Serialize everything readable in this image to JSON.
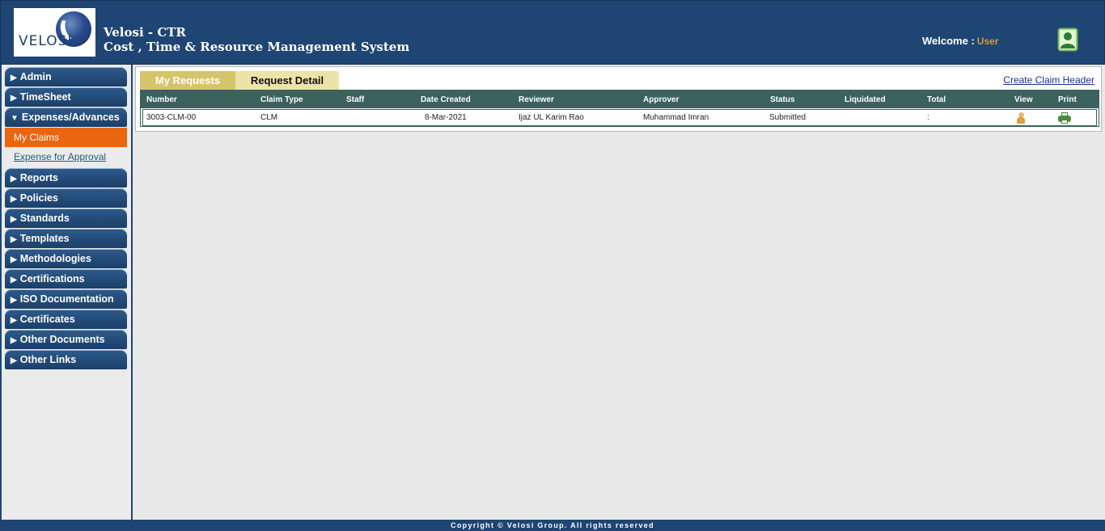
{
  "header": {
    "logo_text": "VELOSI",
    "app_name": "Velosi - CTR",
    "app_subtitle": "Cost , Time & Resource Management System",
    "welcome_label": "Welcome :",
    "user_name": "User"
  },
  "sidebar": {
    "items": [
      {
        "label": "Admin",
        "expanded": false
      },
      {
        "label": "TimeSheet",
        "expanded": false
      },
      {
        "label": "Expenses/Advances",
        "expanded": true
      },
      {
        "label": "Reports",
        "expanded": false
      },
      {
        "label": "Policies",
        "expanded": false
      },
      {
        "label": "Standards",
        "expanded": false
      },
      {
        "label": "Templates",
        "expanded": false
      },
      {
        "label": "Methodologies",
        "expanded": false
      },
      {
        "label": "Certifications",
        "expanded": false
      },
      {
        "label": "ISO Documentation",
        "expanded": false
      },
      {
        "label": "Certificates",
        "expanded": false
      },
      {
        "label": "Other Documents",
        "expanded": false
      },
      {
        "label": "Other Links",
        "expanded": false
      }
    ],
    "collapsed_arrow": "▶",
    "expanded_arrow": "▼",
    "sub_items": {
      "active": "My Claims",
      "link": "Expense for Approval"
    }
  },
  "main": {
    "tabs": {
      "my_requests": "My Requests",
      "request_detail": "Request Detail"
    },
    "create_link": "Create Claim Header",
    "table": {
      "headers": [
        "Number",
        "Claim Type",
        "Staff",
        "Date Created",
        "Reviewer",
        "Approver",
        "Status",
        "Liquidated",
        "Total",
        "View",
        "Print"
      ],
      "rows": [
        {
          "number": "3003-CLM-00",
          "claim_type": "CLM",
          "staff": "",
          "date_created": "8-Mar-2021",
          "reviewer": "Ijaz UL Karim Rao",
          "approver": "Muhammad Imran",
          "status": "Submitted",
          "liquidated": "",
          "total": ":",
          "view_icon": "user-view-icon",
          "print_icon": "printer-icon"
        }
      ]
    }
  },
  "footer": {
    "copyright": "Copyright © Velosi Group. All rights reserved"
  },
  "colors": {
    "brand_navy": "#1e4573",
    "active_orange": "#ea6510",
    "tab_gold": "#d6c46a",
    "table_header": "#3b625d"
  }
}
